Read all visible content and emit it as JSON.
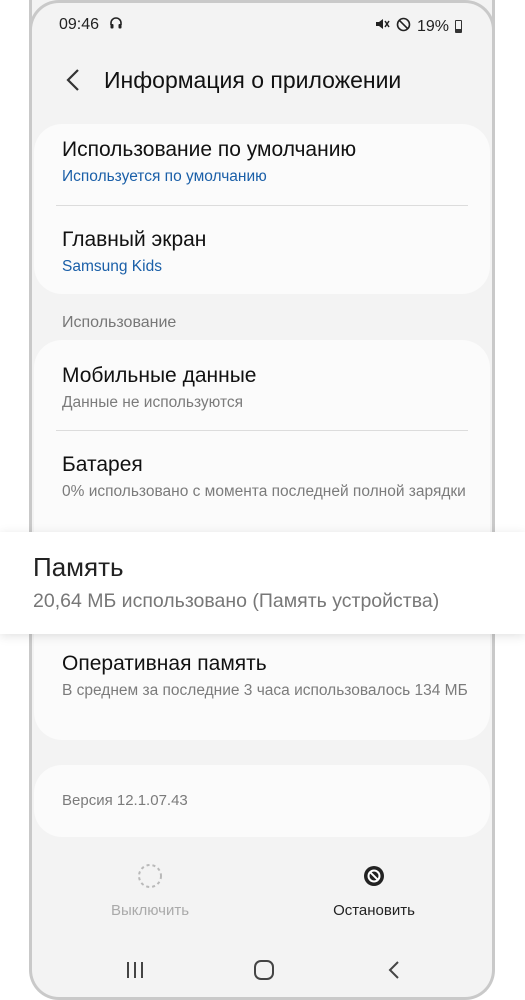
{
  "statusbar": {
    "time": "09:46",
    "battery": "19%",
    "icons": [
      "headphones-icon",
      "mute-icon",
      "do-not-disturb-icon",
      "battery-icon"
    ]
  },
  "header": {
    "title": "Информация о приложении",
    "back_icon": "chevron-left-icon"
  },
  "defaults_card": {
    "items": [
      {
        "title": "Использование по умолчанию",
        "subtitle": "Используется по умолчанию"
      },
      {
        "title": "Главный экран",
        "subtitle": "Samsung Kids"
      }
    ]
  },
  "usage_section": {
    "label": "Использование",
    "items": [
      {
        "title": "Мобильные данные",
        "subtitle": "Данные не используются"
      },
      {
        "title": "Батарея",
        "subtitle": "0% использовано с момента последней полной зарядки"
      },
      {
        "title": "Оперативная память",
        "subtitle": "В среднем за последние 3 часа использовалось 134 МБ"
      }
    ]
  },
  "storage_highlight": {
    "title": "Память",
    "subtitle": "20,64 МБ использовано (Память устройства)"
  },
  "version": {
    "text": "Версия 12.1.07.43"
  },
  "actions": {
    "disable": {
      "label": "Выключить",
      "enabled": false,
      "icon": "disable-icon"
    },
    "force_stop": {
      "label": "Остановить",
      "enabled": true,
      "icon": "stop-icon"
    }
  },
  "navbar": {
    "icons": [
      "recents-icon",
      "home-icon",
      "back-icon"
    ]
  },
  "colors": {
    "accent_blue": "#1a5fa8",
    "background": "#f3f3f3",
    "card": "#fbfbfb"
  }
}
